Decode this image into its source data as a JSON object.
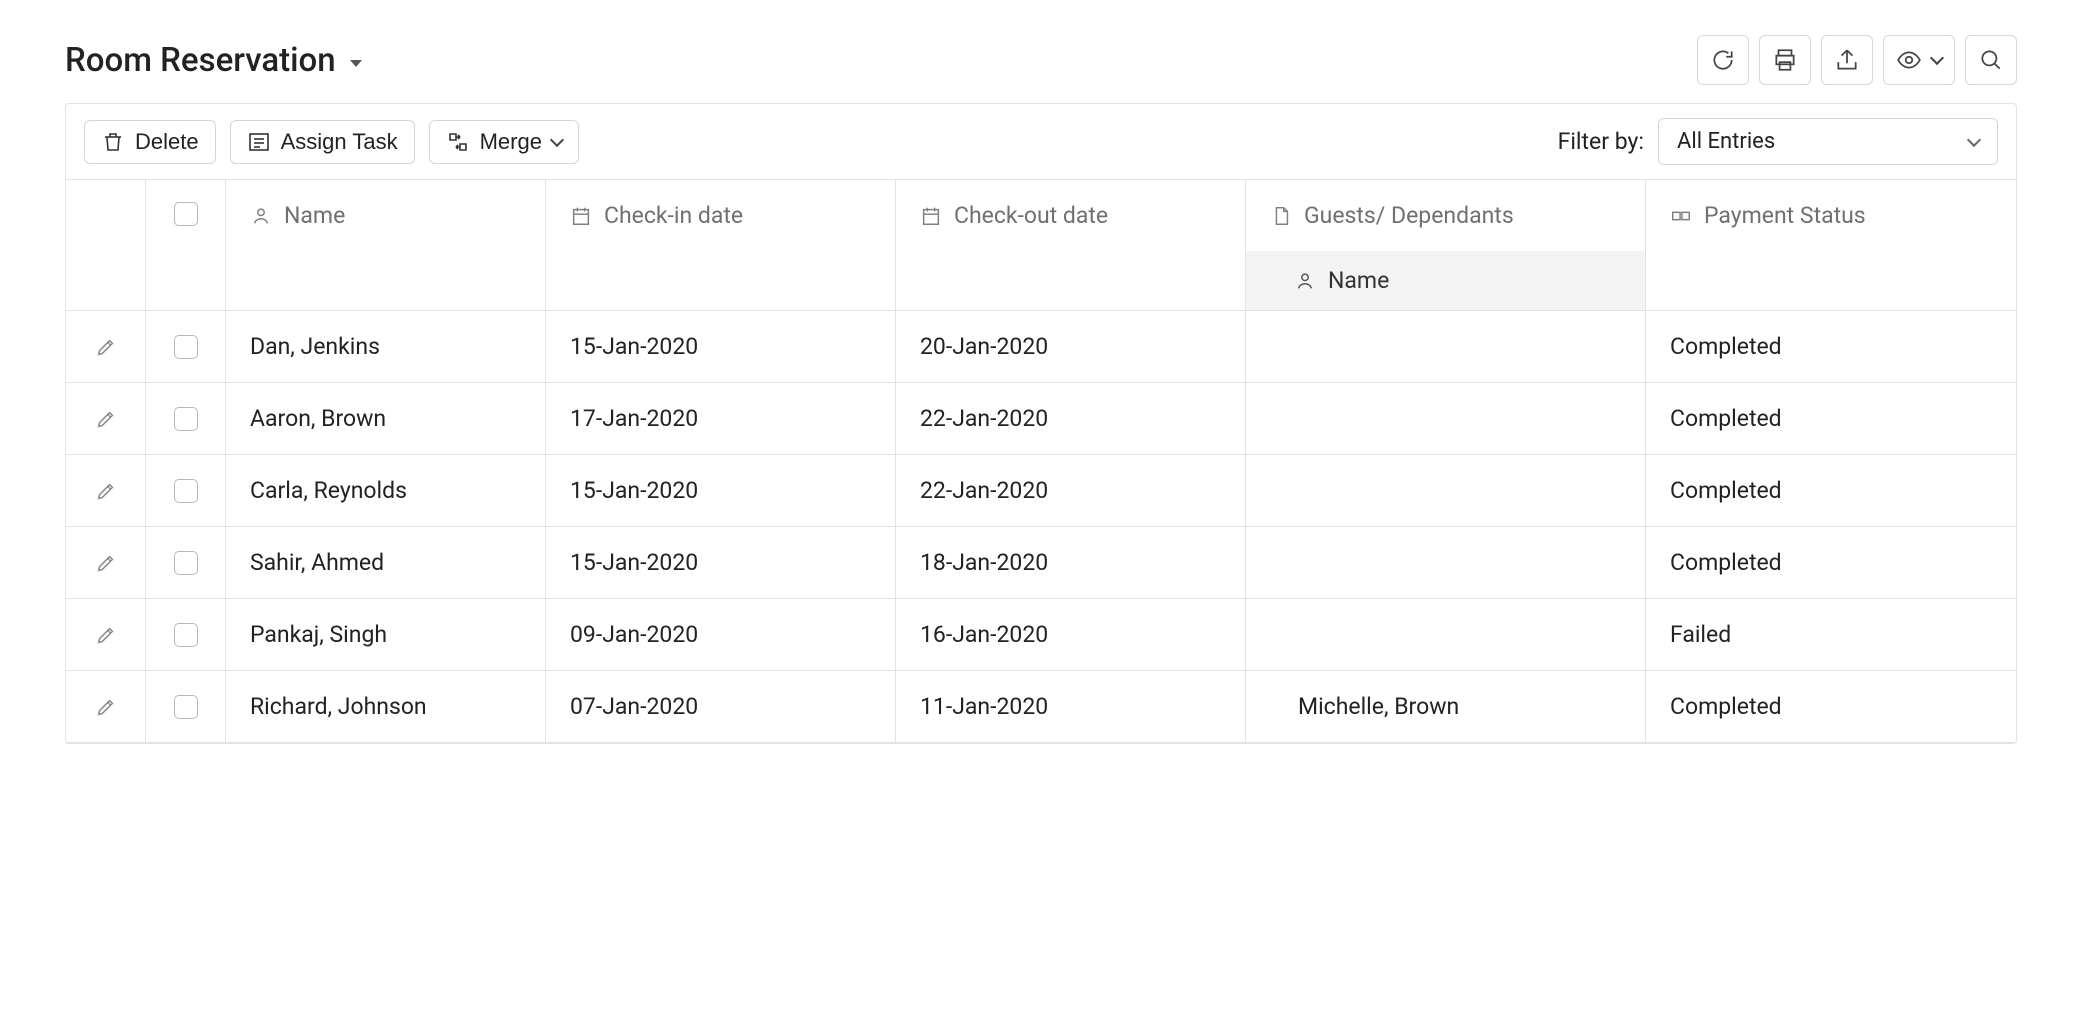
{
  "title": "Room Reservation",
  "toolbar": {
    "delete_label": "Delete",
    "assign_label": "Assign Task",
    "merge_label": "Merge",
    "filter_label": "Filter by:",
    "filter_value": "All Entries"
  },
  "columns": {
    "name": "Name",
    "checkin": "Check-in date",
    "checkout": "Check-out date",
    "guests": "Guests/ Dependants",
    "guests_sub": "Name",
    "payment": "Payment Status"
  },
  "rows": [
    {
      "name": "Dan, Jenkins",
      "checkin": "15-Jan-2020",
      "checkout": "20-Jan-2020",
      "guest": "",
      "payment": "Completed"
    },
    {
      "name": "Aaron, Brown",
      "checkin": "17-Jan-2020",
      "checkout": "22-Jan-2020",
      "guest": "",
      "payment": "Completed"
    },
    {
      "name": "Carla, Reynolds",
      "checkin": "15-Jan-2020",
      "checkout": "22-Jan-2020",
      "guest": "",
      "payment": "Completed"
    },
    {
      "name": "Sahir, Ahmed",
      "checkin": "15-Jan-2020",
      "checkout": "18-Jan-2020",
      "guest": "",
      "payment": "Completed"
    },
    {
      "name": "Pankaj, Singh",
      "checkin": "09-Jan-2020",
      "checkout": "16-Jan-2020",
      "guest": "",
      "payment": "Failed"
    },
    {
      "name": "Richard, Johnson",
      "checkin": "07-Jan-2020",
      "checkout": "11-Jan-2020",
      "guest": "Michelle, Brown",
      "payment": "Completed"
    }
  ]
}
